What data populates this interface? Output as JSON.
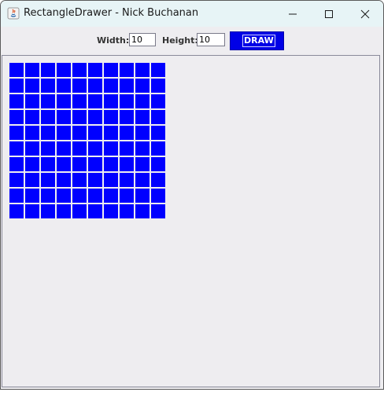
{
  "window": {
    "title": "RectangleDrawer - Nick Buchanan"
  },
  "toolbar": {
    "width_label": "Width:",
    "width_value": "10",
    "height_label": "Height:",
    "height_value": "10",
    "draw_label": "DRAW"
  },
  "canvas": {
    "grid_columns": 10,
    "grid_rows": 10,
    "fill_color": "#0000ff",
    "background_color": "#eeedf0"
  },
  "colors": {
    "titlebar": "#e7f4f6",
    "draw_button": "#0000e6"
  },
  "icons": {
    "app": "java-app-icon",
    "minimize": "minimize-icon",
    "maximize": "maximize-icon",
    "close": "close-icon"
  }
}
